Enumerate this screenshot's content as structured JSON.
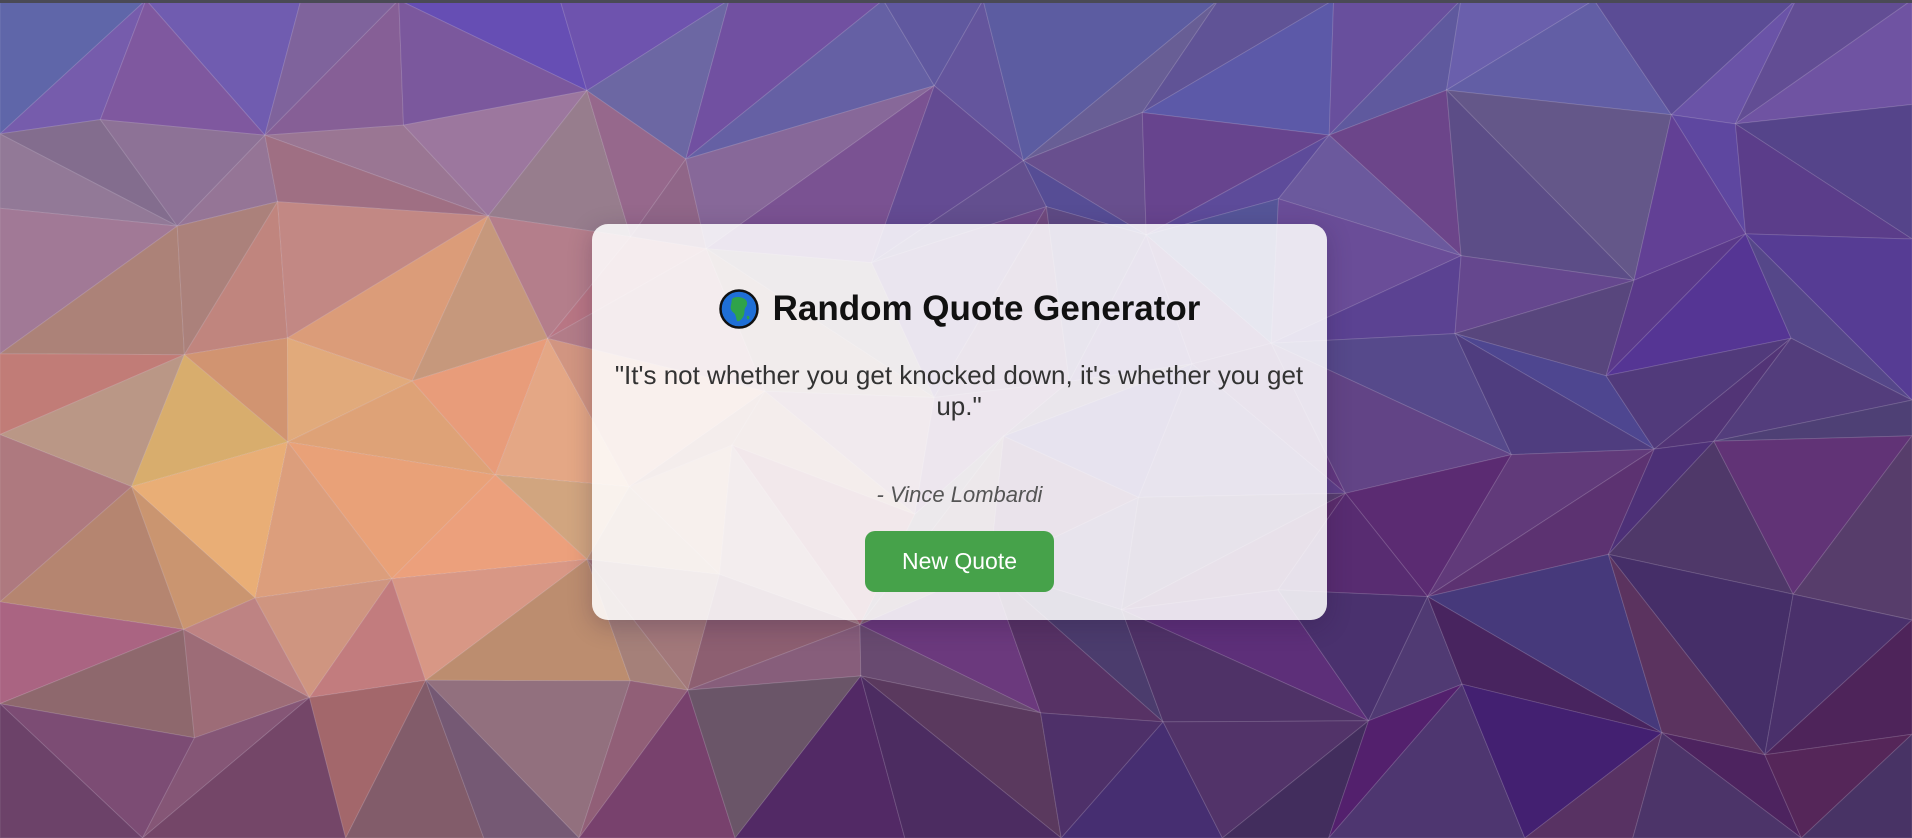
{
  "app": {
    "title": "Random Quote Generator",
    "title_icon": "globe-africa-icon"
  },
  "quote": {
    "text": "\"It's not whether you get knocked down, it's whether you get up.\"",
    "author": "- Vince Lombardi"
  },
  "actions": {
    "new_quote_label": "New Quote"
  },
  "colors": {
    "button": "#46a24a",
    "card": "#ffffff",
    "title": "#111111",
    "bg_warm": "#e8a878",
    "bg_cool": "#6a5aa8",
    "bg_dark": "#4e2a66"
  }
}
